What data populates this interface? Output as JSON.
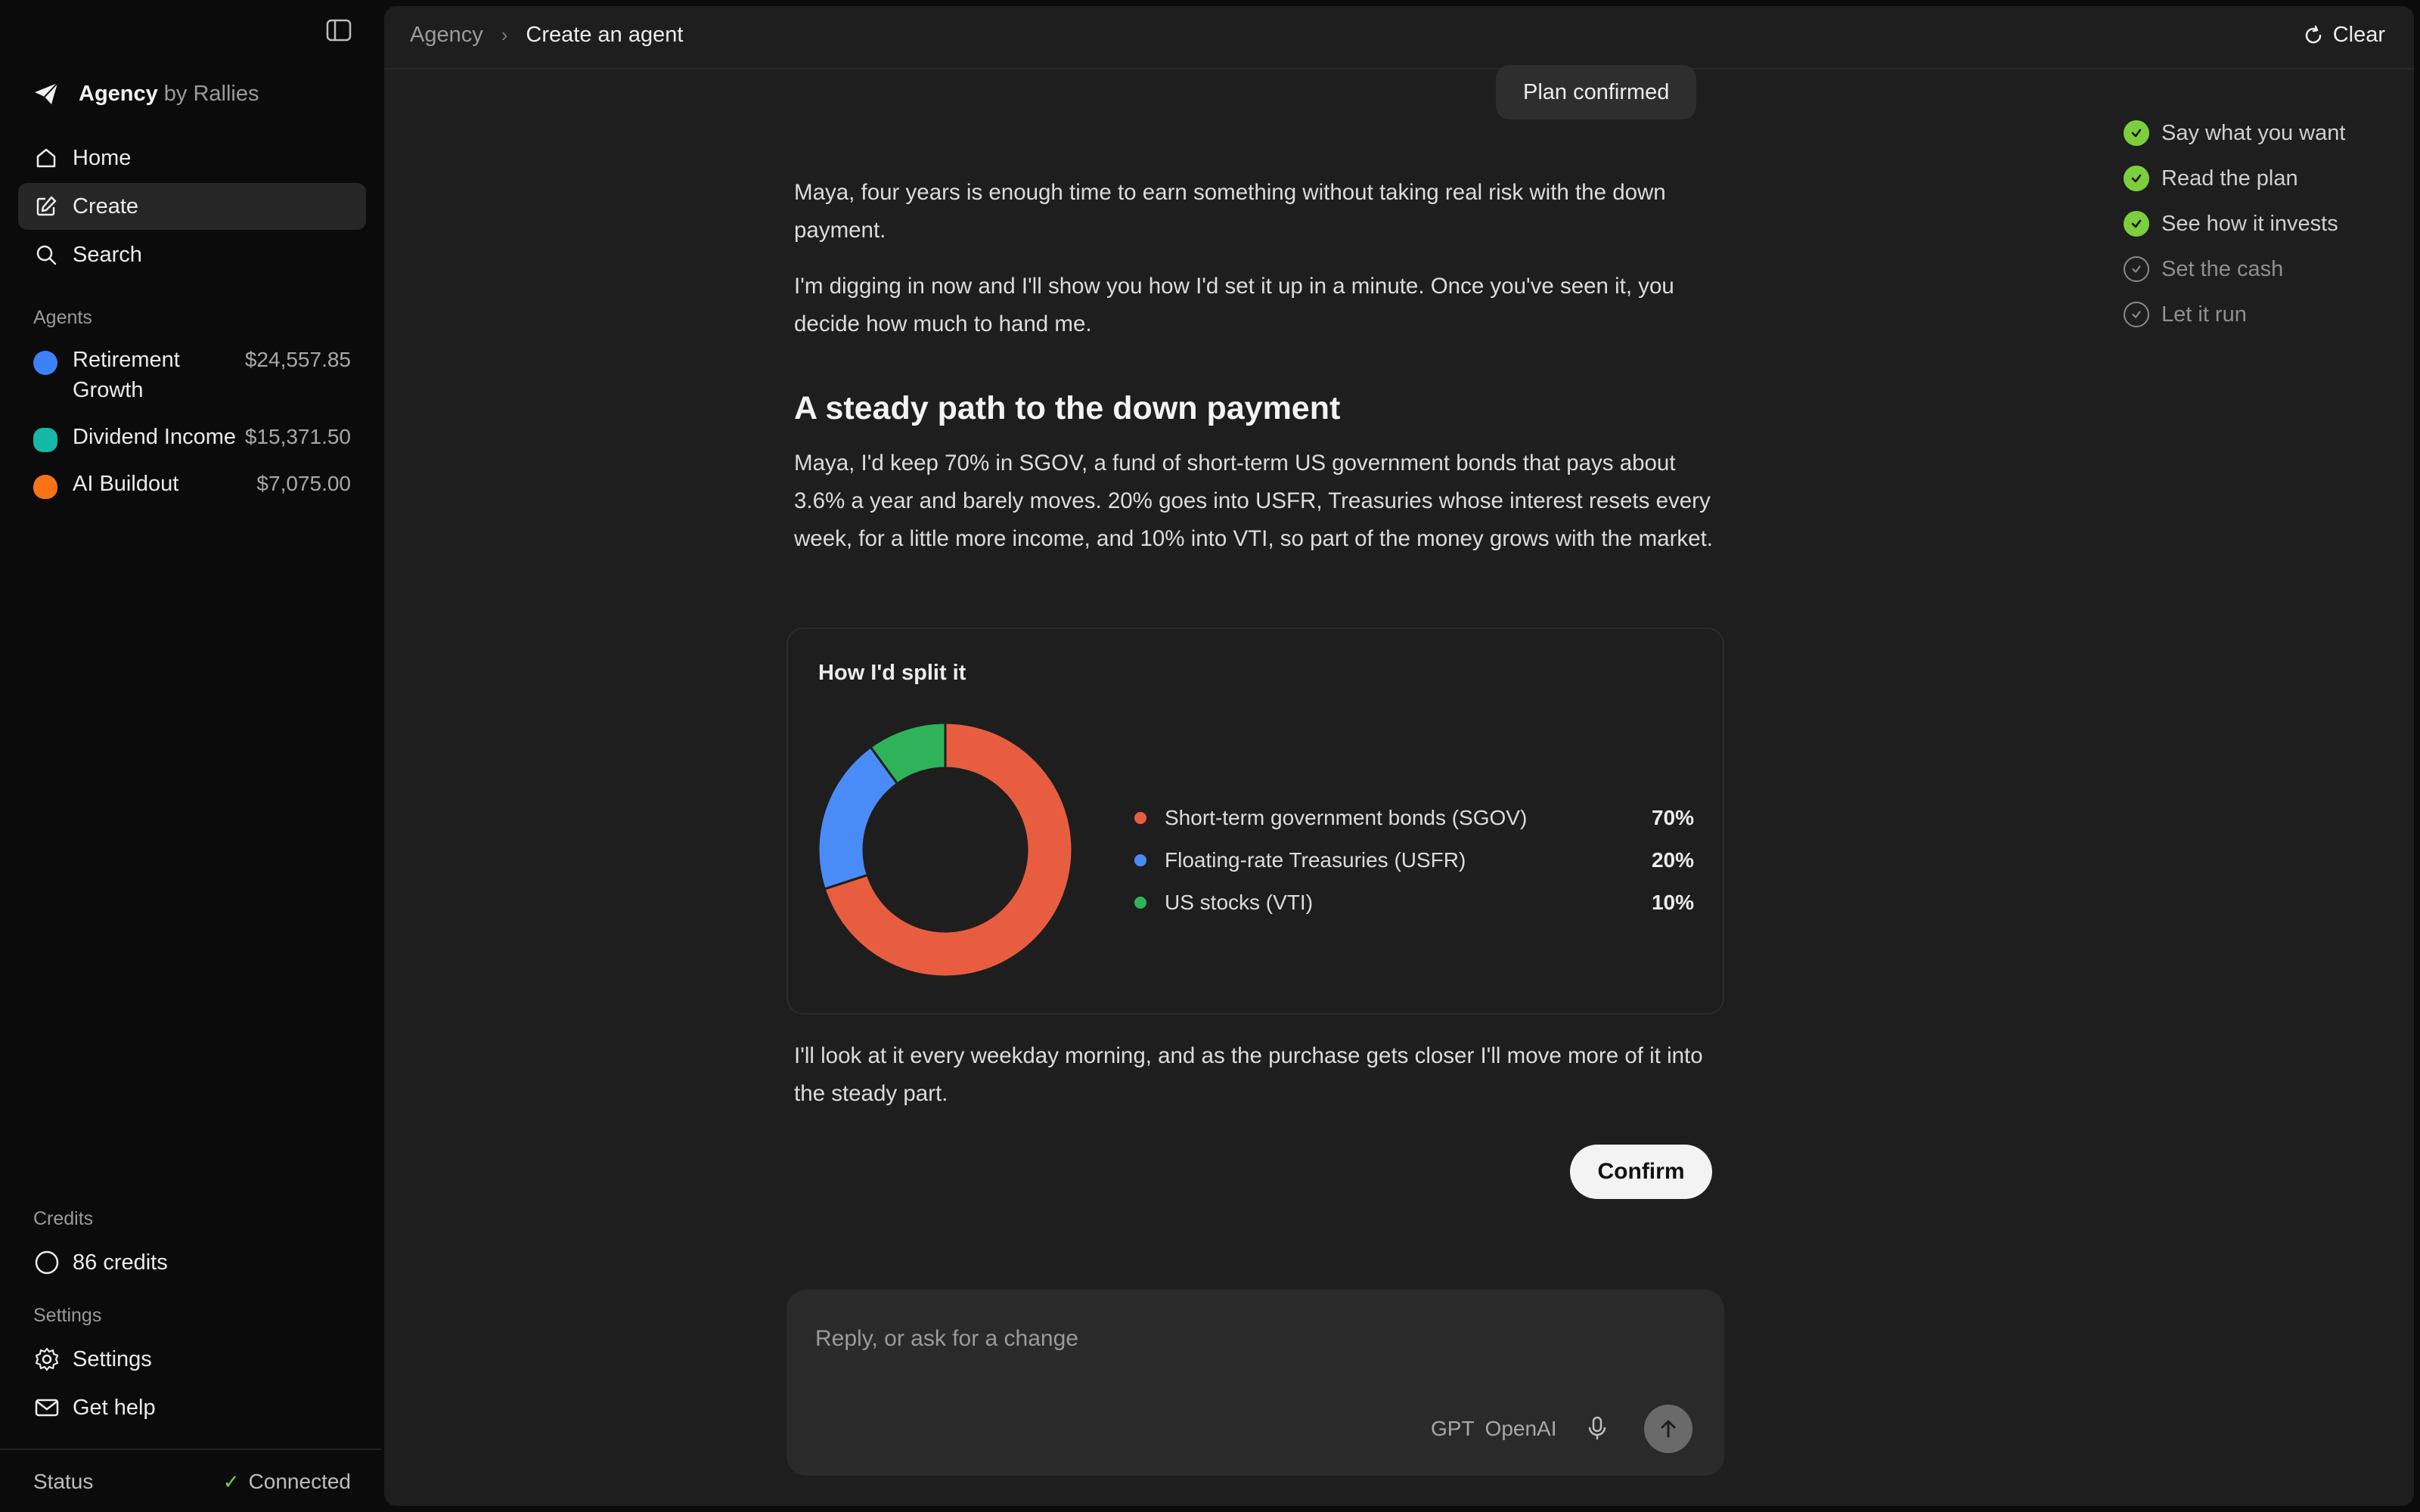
{
  "sidebar": {
    "brand": {
      "name": "Agency",
      "by": "by Rallies"
    },
    "nav": [
      {
        "label": "Home"
      },
      {
        "label": "Create"
      },
      {
        "label": "Search"
      }
    ],
    "agents_label": "Agents",
    "agents": [
      {
        "name": "Retirement Growth",
        "value": "$24,557.85",
        "color": "#3b82f6"
      },
      {
        "name": "Dividend Income",
        "value": "$15,371.50",
        "color": "#14b8a6"
      },
      {
        "name": "AI Buildout",
        "value": "$7,075.00",
        "color": "#f97316"
      }
    ],
    "credits_label": "Credits",
    "credits": "86 credits",
    "settings_label": "Settings",
    "settings": "Settings",
    "help": "Get help",
    "status_label": "Status",
    "status_value": "Connected"
  },
  "topbar": {
    "crumb_root": "Agency",
    "crumb_current": "Create an agent",
    "clear_label": "Clear"
  },
  "chat": {
    "plan_pill": "Plan confirmed",
    "p1": "Maya, four years is enough time to earn something without taking real risk with the down payment.",
    "p2": "I'm digging in now and I'll show you how I'd set it up in a minute. Once you've seen it, you decide how much to hand me.",
    "heading": "A steady path to the down payment",
    "p3": "Maya, I'd keep 70% in SGOV, a fund of short-term US government bonds that pays about 3.6% a year and barely moves. 20% goes into USFR, Treasuries whose interest resets every week, for a little more income, and 10% into VTI, so part of the money grows with the market.",
    "p4": "I'll look at it every weekday morning, and as the purchase gets closer I'll move more of it into the steady part.",
    "confirm_label": "Confirm"
  },
  "chart_data": {
    "type": "pie",
    "title": "How I'd split it",
    "categories": [
      "Short-term government bonds (SGOV)",
      "Floating-rate Treasuries (USFR)",
      "US stocks (VTI)"
    ],
    "values": [
      70,
      20,
      10
    ],
    "labels": [
      "70%",
      "20%",
      "10%"
    ],
    "colors": [
      "#e85d3f",
      "#4a8cf7",
      "#2fb35a"
    ],
    "legend": "right"
  },
  "composer": {
    "placeholder": "Reply, or ask for a change",
    "model_name": "GPT",
    "provider": "OpenAI"
  },
  "steps": [
    {
      "label": "Say what you want",
      "done": true
    },
    {
      "label": "Read the plan",
      "done": true
    },
    {
      "label": "See how it invests",
      "done": true
    },
    {
      "label": "Set the cash",
      "done": false
    },
    {
      "label": "Let it run",
      "done": false
    }
  ]
}
